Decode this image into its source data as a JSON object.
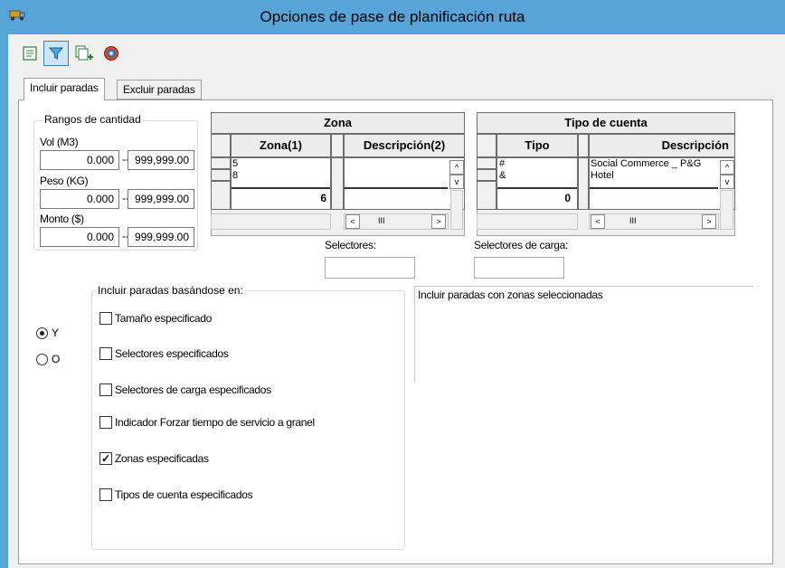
{
  "window": {
    "title": "Opciones de pase de planificación ruta"
  },
  "toolbar": {
    "icons": [
      "list-icon",
      "filter-icon",
      "copy-add-icon",
      "settings-gear-icon"
    ]
  },
  "tabs": [
    {
      "label": "Incluir paradas",
      "selected": true
    },
    {
      "label": "Excluir paradas",
      "selected": false
    }
  ],
  "ranges": {
    "title": "Rangos de cantidad",
    "vol": {
      "label": "Vol (M3)",
      "min": "0.000",
      "max": "999,999.00"
    },
    "peso": {
      "label": "Peso (KG)",
      "min": "0.000",
      "max": "999,999.00"
    },
    "monto": {
      "label": "Monto ($)",
      "min": "0.000",
      "max": "999,999.00"
    },
    "separator": "---"
  },
  "zona_grid": {
    "caption": "Zona",
    "col1": "Zona(1)",
    "col2": "Descripción(2)",
    "rows": [
      {
        "zona": "5",
        "desc": ""
      },
      {
        "zona": "8",
        "desc": ""
      }
    ],
    "total": "6"
  },
  "cuenta_grid": {
    "caption": "Tipo de cuenta",
    "col1": "Tipo",
    "col2": "Descripción",
    "rows": [
      {
        "tipo": "#",
        "desc": "Social Commerce _ P&G"
      },
      {
        "tipo": "&",
        "desc": "Hotel"
      }
    ],
    "total": "0"
  },
  "selectors": {
    "label": "Selectores:",
    "value": ""
  },
  "load_selectors": {
    "label": "Selectores de carga:",
    "value": ""
  },
  "logic": {
    "y_label": "Y",
    "o_label": "O",
    "selected": "Y"
  },
  "include_group": {
    "title": "Incluir paradas basándose en:",
    "options": [
      {
        "label": "Tamaño especificado",
        "checked": false
      },
      {
        "label": "Selectores especificados",
        "checked": false
      },
      {
        "label": "Selectores de carga especificados",
        "checked": false
      },
      {
        "label": "Indicador Forzar tiempo de servicio a granel",
        "checked": false
      },
      {
        "label": "Zonas especificadas",
        "checked": true
      },
      {
        "label": "Tipos de cuenta especificados",
        "checked": false
      }
    ]
  },
  "description": "Incluir paradas con zonas seleccionadas",
  "glyphs": {
    "up": "^",
    "down": "v",
    "left": "<",
    "right": ">",
    "thumb": "III",
    "check": "✓"
  }
}
